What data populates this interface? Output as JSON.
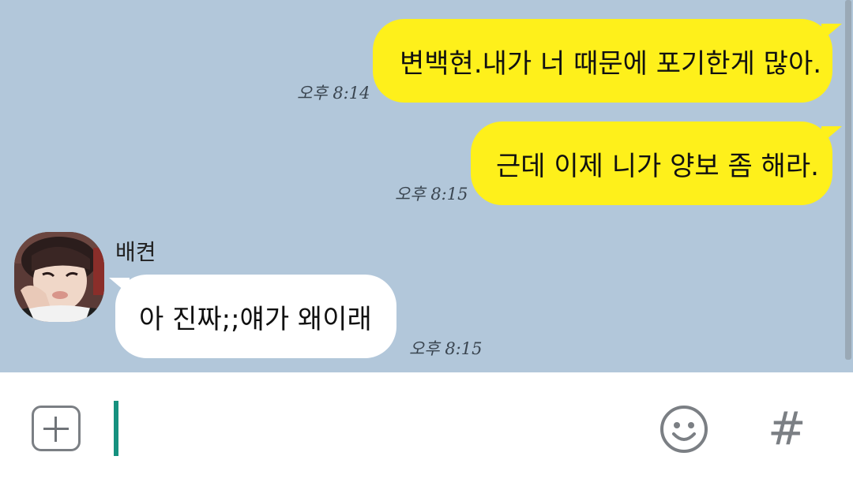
{
  "messages": [
    {
      "side": "me",
      "text": "변백현.내가 너 때문에 포기한게 많아.",
      "time": "오후 8:14"
    },
    {
      "side": "me",
      "text": "근데 이제 니가 양보 좀 해라.",
      "time": "오후 8:15"
    },
    {
      "side": "other",
      "sender": "배켠",
      "text": "아 진짜;;얘가 왜이래",
      "time": "오후 8:15"
    }
  ],
  "icons": {
    "attach": "plus-icon",
    "emoji": "smiley-icon",
    "hash": "hash-icon",
    "hash_glyph": "#"
  },
  "colors": {
    "chat_background": "#b2c7da",
    "my_bubble": "#fef01b",
    "other_bubble": "#ffffff",
    "cursor": "#16917f"
  }
}
